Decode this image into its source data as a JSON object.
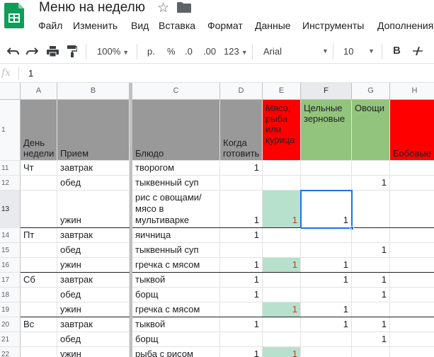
{
  "doc_title": "Меню на неделю",
  "menu": [
    "Файл",
    "Изменить",
    "Вид",
    "Вставка",
    "Формат",
    "Данные",
    "Инструменты",
    "Дополнения"
  ],
  "toolbar": {
    "zoom": "100%",
    "currency": "р.",
    "percent": "%",
    "dec_less": ".0",
    "dec_more": ".00",
    "more_formats": "123",
    "font": "Arial",
    "font_size": "10",
    "bold": "B"
  },
  "formula_bar": {
    "fx": "fx",
    "value": "1"
  },
  "columns": [
    "A",
    "B",
    "C",
    "D",
    "E",
    "F",
    "G",
    "H"
  ],
  "header_row": {
    "row_num": "1",
    "cells": [
      "День недели",
      "Прием",
      "Блюдо",
      "Когда готовить",
      "Мясо, рыба или курица",
      "Цельные зерновые",
      "Овощи",
      "Бобовые"
    ]
  },
  "rows": [
    {
      "num": "11",
      "cells": [
        "Чт",
        "завтрак",
        "овсянка с творогом",
        "1",
        "",
        "",
        "",
        ""
      ]
    },
    {
      "num": "12",
      "cells": [
        "",
        "обед",
        "тыквенный суп",
        "",
        "",
        "",
        "1",
        ""
      ]
    },
    {
      "num": "13",
      "cells": [
        "",
        "ужин",
        "рис с овощами/мясо в мультиварке",
        "1",
        "1",
        "1",
        "",
        ""
      ]
    },
    {
      "num": "14",
      "cells": [
        "Пт",
        "завтрак",
        "яичница",
        "1",
        "",
        "",
        "",
        ""
      ]
    },
    {
      "num": "15",
      "cells": [
        "",
        "обед",
        "тыквенный суп",
        "",
        "",
        "",
        "1",
        ""
      ]
    },
    {
      "num": "16",
      "cells": [
        "",
        "ужин",
        "гречка с мясом",
        "1",
        "1",
        "1",
        "",
        ""
      ]
    },
    {
      "num": "17",
      "cells": [
        "Сб",
        "завтрак",
        "пшеничка с тыквой",
        "1",
        "",
        "1",
        "1",
        ""
      ]
    },
    {
      "num": "18",
      "cells": [
        "",
        "обед",
        "борщ",
        "1",
        "",
        "",
        "1",
        ""
      ]
    },
    {
      "num": "19",
      "cells": [
        "",
        "ужин",
        "гречка с мясом",
        "",
        "1",
        "1",
        "",
        ""
      ]
    },
    {
      "num": "20",
      "cells": [
        "Вс",
        "завтрак",
        "пшеничка с тыквой",
        "1",
        "",
        "1",
        "1",
        ""
      ]
    },
    {
      "num": "21",
      "cells": [
        "",
        "обед",
        "борщ",
        "",
        "",
        "",
        "1",
        ""
      ]
    },
    {
      "num": "22",
      "cells": [
        "",
        "ужин",
        "рыба с рисом",
        "1",
        "1",
        "",
        "",
        ""
      ]
    }
  ],
  "colors": {
    "header_grey": "#999999",
    "header_red": "#ff0000",
    "header_green": "#93c47d",
    "meat_fill": "#b7e1cd",
    "selection": "#1a73e8",
    "logo_green": "#0f9d58"
  },
  "selected_cell": "F13"
}
